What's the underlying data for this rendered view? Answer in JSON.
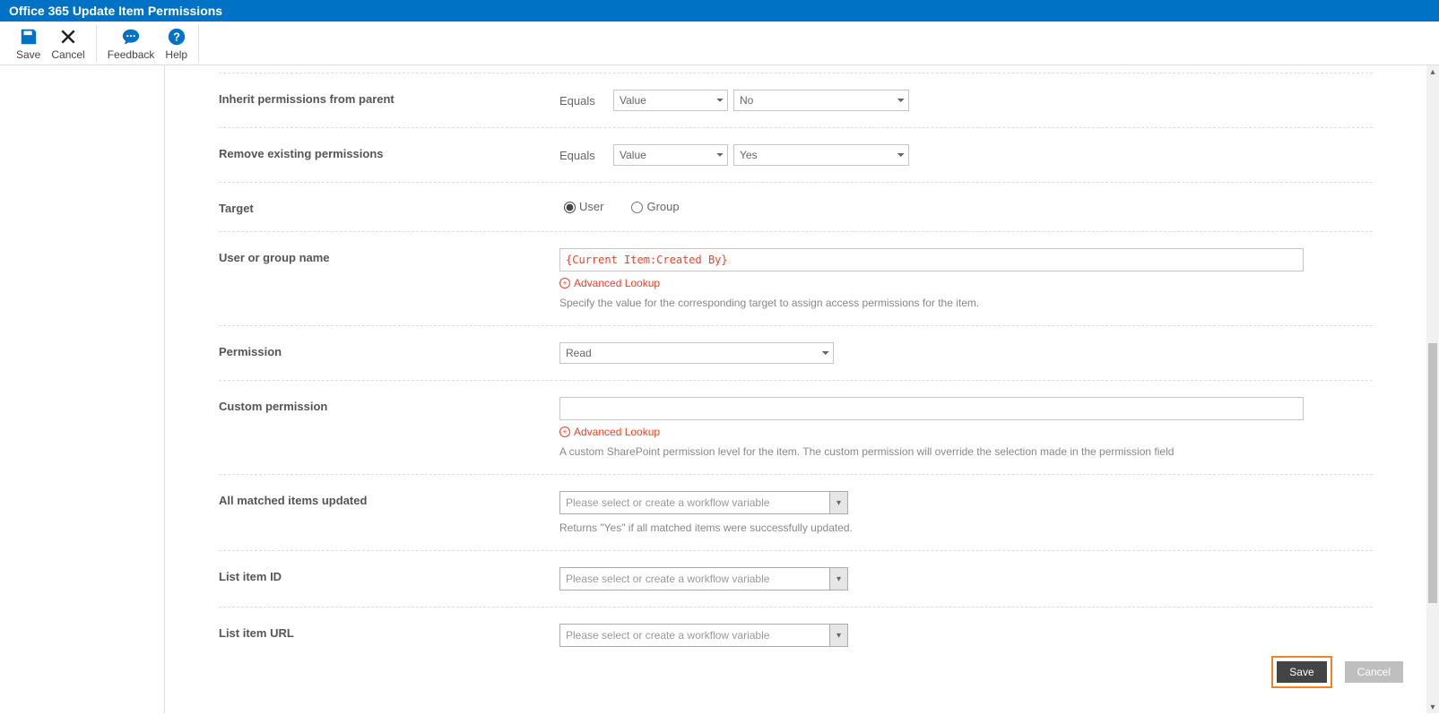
{
  "header": {
    "title": "Office 365 Update Item Permissions"
  },
  "ribbon": {
    "save": "Save",
    "cancel": "Cancel",
    "feedback": "Feedback",
    "help": "Help"
  },
  "rows": {
    "inherit": {
      "label": "Inherit permissions from parent",
      "operator": "Equals",
      "mode": "Value",
      "value": "No"
    },
    "remove": {
      "label": "Remove existing permissions",
      "operator": "Equals",
      "mode": "Value",
      "value": "Yes"
    },
    "target": {
      "label": "Target",
      "options": {
        "user": "User",
        "group": "Group"
      },
      "selected": "user"
    },
    "user_group": {
      "label": "User or group name",
      "value": "{Current Item:Created By}",
      "adv_lookup": "Advanced Lookup",
      "help": "Specify the value for the corresponding target to assign access permissions for the item."
    },
    "permission": {
      "label": "Permission",
      "value": "Read"
    },
    "custom": {
      "label": "Custom permission",
      "value": "",
      "adv_lookup": "Advanced Lookup",
      "help": "A custom SharePoint permission level for the item. The custom permission will override the selection made in the permission field"
    },
    "all_matched": {
      "label": "All matched items updated",
      "placeholder": "Please select or create a workflow variable",
      "help": "Returns \"Yes\" if all matched items were successfully updated."
    },
    "item_id": {
      "label": "List item ID",
      "placeholder": "Please select or create a workflow variable"
    },
    "item_url": {
      "label": "List item URL",
      "placeholder": "Please select or create a workflow variable"
    }
  },
  "footer": {
    "save": "Save",
    "cancel": "Cancel"
  }
}
